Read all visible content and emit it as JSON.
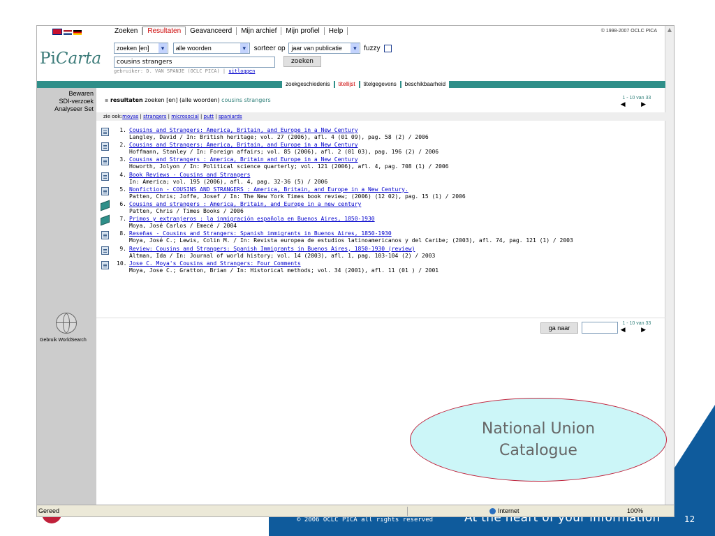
{
  "browser": {
    "status_text": "Gereed",
    "zone": "Internet",
    "zoom": "100%"
  },
  "header": {
    "logo_pre": "Pi",
    "logo_post": "Carta",
    "nav": [
      {
        "label": "Zoeken",
        "active": false
      },
      {
        "label": "Resultaten",
        "active": true
      },
      {
        "label": "Geavanceerd",
        "active": false
      },
      {
        "label": "Mijn archief",
        "active": false
      },
      {
        "label": "Mijn profiel",
        "active": false
      },
      {
        "label": "Help",
        "active": false
      }
    ],
    "copyright": "© 1998-2007 OCLC PICA"
  },
  "search": {
    "index_select": "zoeken [en]",
    "mode_select": "alle woorden",
    "sort_label": "sorteer op",
    "sort_select": "jaar van publicatie",
    "fuzzy_label": "fuzzy",
    "query": "cousins strangers",
    "submit_label": "zoeken",
    "user_prefix": "gebruiker: D. VAN SPANJE (OCLC PICA) |",
    "logout_label": "uitloggen"
  },
  "subtabs": [
    {
      "label": "zoekgeschiedenis",
      "active": false
    },
    {
      "label": "titellijst",
      "active": true
    },
    {
      "label": "titelgegevens",
      "active": false
    },
    {
      "label": "beschikbaarheid",
      "active": false
    }
  ],
  "sidebar": {
    "items": [
      "Bewaren",
      "SDI-verzoek",
      "Analyseer Set"
    ],
    "worldsearch_label": "Gebruik WorldSearch"
  },
  "results": {
    "head_bold": "resultaten",
    "head_plain": "zoeken [en] (alle woorden)",
    "head_query": "cousins strangers",
    "pager_text": "1 - 10 van 33",
    "pager_arrows": "◀ ▶",
    "see_also_label": "zie ook:",
    "see_also": [
      "moyas",
      "strangers",
      "microsocial",
      "putt",
      "spaniards"
    ],
    "goto_label": "ga naar",
    "items": [
      {
        "num": "1.",
        "icon": "doc",
        "title": "Cousins and Strangers: America, Britain, and Europe in a New Century",
        "detail": "Langley, David / In: British heritage; vol. 27 (2006), afl. 4 (01 09), pag. 58 (2) / 2006"
      },
      {
        "num": "2.",
        "icon": "doc",
        "title": "Cousins and Strangers: America, Britain, and Europe in a New Century",
        "detail": "Hoffmann, Stanley / In: Foreign affairs; vol. 85 (2006), afl. 2 (01 03), pag. 196 (2) / 2006"
      },
      {
        "num": "3.",
        "icon": "doc",
        "title": "Cousins and Strangers : America, Britain and Europe in a New Century",
        "detail": "Howorth, Jolyon / In: Political science quarterly; vol. 121 (2006), afl. 4, pag. 708 (1) / 2006"
      },
      {
        "num": "4.",
        "icon": "doc",
        "title": "Book Reviews - Cousins and Strangers",
        "detail": "In: America; vol. 195 (2006), afl. 4, pag. 32-36 (5) / 2006"
      },
      {
        "num": "5.",
        "icon": "doc",
        "title": "Nonfiction - COUSINS AND STRANGERS : America, Britain, and Europe in a New Century.",
        "detail": "Patten, Chris; Joffe, Josef / In: The New York Times book review; (2006) (12 02), pag. 15 (1) / 2006"
      },
      {
        "num": "6.",
        "icon": "book",
        "title": "Cousins and strangers : America, Britain, and Europe in a new century",
        "detail": "Patten, Chris / Times Books / 2006"
      },
      {
        "num": "7.",
        "icon": "book",
        "title": "Primos y extranjeros : la inmigración española en Buenos Aires, 1850-1930",
        "detail": "Moya, José Carlos / Emecé / 2004"
      },
      {
        "num": "8.",
        "icon": "doc",
        "title": "Reseñas - Cousins and Strangers: Spanish immigrants in Buenos Aires, 1850-1930",
        "detail": "Moya, José C.; Lewis, Colin M. / In: Revista europea de estudios latinoamericanos y del Caribe; (2003), afl. 74, pag. 121 (1) / 2003"
      },
      {
        "num": "9.",
        "icon": "doc",
        "title": "Review: Cousins and Strangers: Spanish Immigrants in Buenos Aires, 1850-1930 (review)",
        "detail": "Altman, Ida / In: Journal of world history; vol. 14 (2003), afl. 1, pag. 103-104 (2) / 2003"
      },
      {
        "num": "10.",
        "icon": "doc",
        "title": "Jose C. Moya's Cousins and Strangers: Four Comments",
        "detail": "Moya, Jose C.; Gratton, Brian / In: Historical methods; vol. 34 (2001), afl. 11 (01 ) / 2001"
      }
    ]
  },
  "slide": {
    "callout_line1": "National Union",
    "callout_line2": "Catalogue",
    "copyright": "© 2006 OCLC PICA all rights reserved",
    "tagline": "At the heart of your information",
    "slide_number": "12"
  }
}
